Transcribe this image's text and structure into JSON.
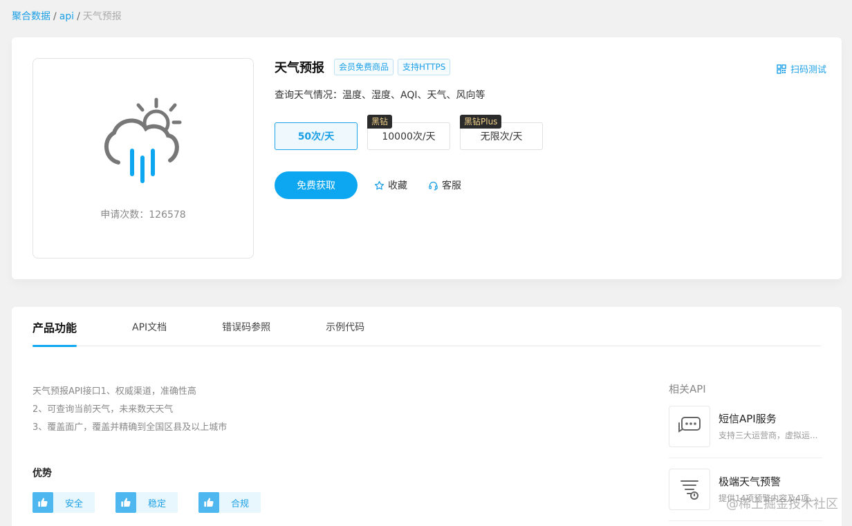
{
  "breadcrumb": {
    "home": "聚合数据",
    "sep1": "/",
    "section": "api",
    "sep2": "/",
    "current": "天气预报"
  },
  "product": {
    "title": "天气预报",
    "tags": [
      "会员免费商品",
      "支持HTTPS"
    ],
    "scan_test": "扫码测试",
    "description": "查询天气情况：温度、湿度、AQI、天气、风向等",
    "apply_count": "申请次数：126578",
    "icon": "weather-rain-sun-icon"
  },
  "plans": [
    {
      "label": "50次/天",
      "badge": ""
    },
    {
      "label": "10000次/天",
      "badge": "黑钻"
    },
    {
      "label": "无限次/天",
      "badge": "黑钻Plus"
    }
  ],
  "actions": {
    "primary": "免费获取",
    "favorite": "收藏",
    "service": "客服"
  },
  "tabs": [
    "产品功能",
    "API文档",
    "错误码参照",
    "示例代码"
  ],
  "intro": {
    "line1": "天气预报API接口1、权威渠道，准确性高",
    "line2": "2、可查询当前天气，未来数天天气",
    "line3": "3、覆盖面广，覆盖并精确到全国区县及以上城市"
  },
  "advantages": {
    "title": "优势",
    "items": [
      "安全",
      "稳定",
      "合规"
    ]
  },
  "related": {
    "title": "相关API",
    "items": [
      {
        "name": "短信API服务",
        "desc": "支持三大运营商，虚拟运..."
      },
      {
        "name": "极端天气预警",
        "desc": "提供14项预警内容及4项..."
      }
    ]
  },
  "watermark": "@稀土掘金技术社区",
  "colors": {
    "accent": "#0ca7f0",
    "badge_bg": "#2b2b2b",
    "badge_text": "#f3d38a"
  }
}
